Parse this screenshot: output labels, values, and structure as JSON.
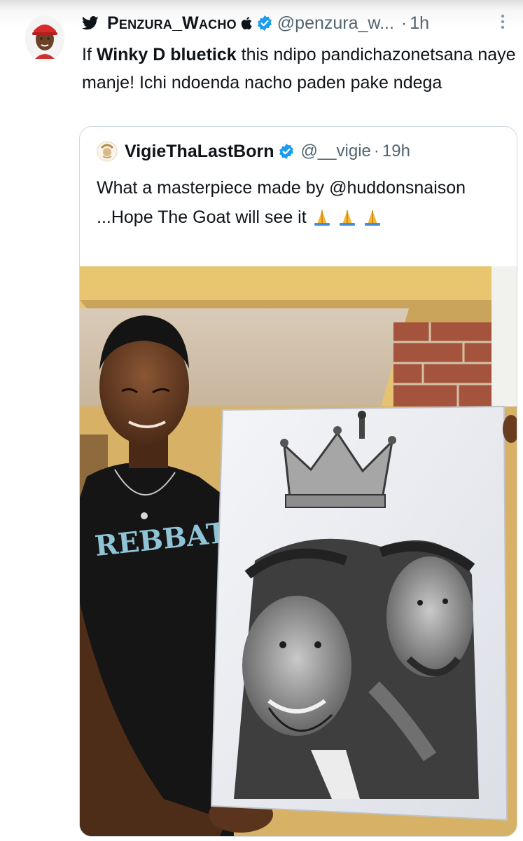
{
  "tweet": {
    "display_name": "Penzura_Wacho",
    "handle": "@penzura_w...",
    "separator": "·",
    "time": "1h",
    "text_prefix": "If ",
    "text_bold": "Winky D bluetick",
    "text_suffix": " this ndipo pandichazonetsana naye manje! Ichi ndoenda nacho paden pake ndega",
    "icons": {
      "bird": "twitter-bird-icon",
      "apple": "apple-logo-icon",
      "verified": "verified-badge-icon",
      "more": "more-options-icon"
    }
  },
  "quoted": {
    "display_name": "VigieThaLastBorn",
    "handle": "@__vigie",
    "separator": "·",
    "time": "19h",
    "text": "What a masterpiece made by @huddonsnaison ...Hope The Goat will see it",
    "emoji": "folded-hands-emoji"
  },
  "image": {
    "shirt_text": "REBBAT"
  },
  "colors": {
    "text": "#0f1419",
    "muted": "#536471",
    "verified": "#1d9bf0",
    "border": "#cfd9de"
  }
}
